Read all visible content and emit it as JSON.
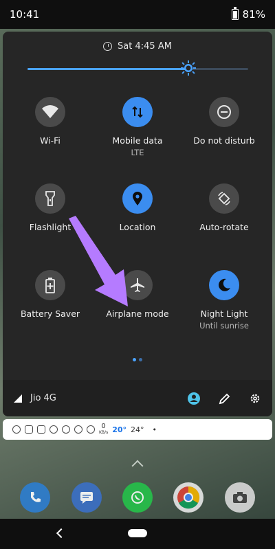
{
  "status_bar": {
    "time": "10:41",
    "battery": "81%"
  },
  "quick_settings": {
    "alarm": "Sat 4:45 AM",
    "brightness_level": 0.73,
    "tiles": [
      {
        "id": "wifi",
        "label": "Wi-Fi",
        "sublabel": "",
        "active": false,
        "icon": "wifi-icon"
      },
      {
        "id": "mobile-data",
        "label": "Mobile data",
        "sublabel": "LTE",
        "active": true,
        "icon": "mobile-data-icon"
      },
      {
        "id": "dnd",
        "label": "Do not disturb",
        "sublabel": "",
        "active": false,
        "icon": "do-not-disturb-icon"
      },
      {
        "id": "flashlight",
        "label": "Flashlight",
        "sublabel": "",
        "active": false,
        "icon": "flashlight-icon"
      },
      {
        "id": "location",
        "label": "Location",
        "sublabel": "",
        "active": true,
        "icon": "location-icon"
      },
      {
        "id": "auto-rotate",
        "label": "Auto-rotate",
        "sublabel": "",
        "active": false,
        "icon": "rotate-icon"
      },
      {
        "id": "battery-saver",
        "label": "Battery Saver",
        "sublabel": "",
        "active": false,
        "icon": "battery-saver-icon"
      },
      {
        "id": "airplane",
        "label": "Airplane mode",
        "sublabel": "",
        "active": false,
        "icon": "airplane-icon"
      },
      {
        "id": "night-light",
        "label": "Night Light",
        "sublabel": "Until sunrise",
        "active": true,
        "icon": "moon-icon"
      }
    ],
    "carrier": "Jio 4G"
  },
  "notification_bar": {
    "speed_value": "0",
    "speed_unit": "KB/s",
    "temp_1": "20°",
    "temp_2": "24°",
    "dot": "•"
  },
  "colors": {
    "accent": "#3b8df0",
    "panel": "#262626",
    "arrow": "#b57bff"
  }
}
